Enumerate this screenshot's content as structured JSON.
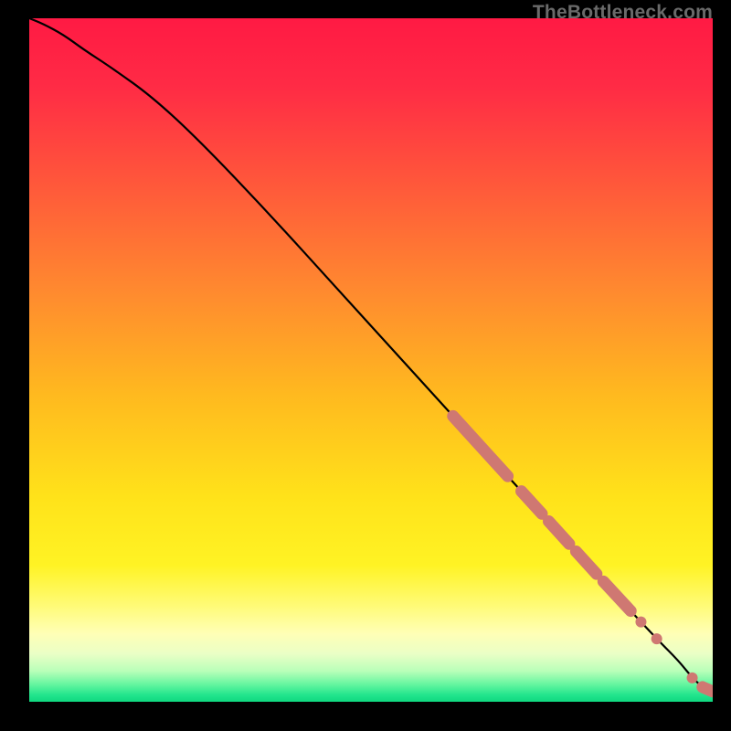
{
  "watermark": "TheBottleneck.com",
  "colors": {
    "page_bg": "#000000",
    "marker": "#cf7872",
    "curve": "#000000",
    "gradient_stops": [
      {
        "offset": 0.0,
        "color": "#ff1a44"
      },
      {
        "offset": 0.1,
        "color": "#ff2b45"
      },
      {
        "offset": 0.25,
        "color": "#ff5a3a"
      },
      {
        "offset": 0.4,
        "color": "#ff8a2f"
      },
      {
        "offset": 0.55,
        "color": "#ffb91f"
      },
      {
        "offset": 0.7,
        "color": "#ffe21a"
      },
      {
        "offset": 0.8,
        "color": "#fff324"
      },
      {
        "offset": 0.86,
        "color": "#fffb78"
      },
      {
        "offset": 0.9,
        "color": "#ffffb6"
      },
      {
        "offset": 0.93,
        "color": "#eaffc6"
      },
      {
        "offset": 0.955,
        "color": "#b9ffb9"
      },
      {
        "offset": 0.975,
        "color": "#63f59f"
      },
      {
        "offset": 0.99,
        "color": "#22e58d"
      },
      {
        "offset": 1.0,
        "color": "#0fd87f"
      }
    ]
  },
  "chart_data": {
    "type": "line",
    "title": "",
    "xlabel": "",
    "ylabel": "",
    "xlim": [
      0,
      100
    ],
    "ylim": [
      0,
      100
    ],
    "grid": false,
    "series": [
      {
        "name": "curve",
        "x": [
          0,
          2,
          5,
          8,
          12,
          18,
          25,
          35,
          45,
          55,
          65,
          75,
          85,
          92,
          95,
          97,
          99,
          100
        ],
        "y": [
          100,
          99.2,
          97.6,
          95.4,
          92.8,
          88.5,
          82.0,
          71.5,
          60.5,
          49.5,
          38.5,
          27.5,
          16.5,
          9.0,
          6.0,
          3.5,
          1.7,
          1.5
        ]
      }
    ],
    "markers": [
      {
        "name": "cluster",
        "x_range": [
          62,
          70
        ],
        "style": "dense-segment"
      },
      {
        "name": "cluster",
        "x_range": [
          72,
          75
        ],
        "style": "dense-segment"
      },
      {
        "name": "cluster",
        "x_range": [
          76,
          79
        ],
        "style": "dense-segment"
      },
      {
        "name": "cluster",
        "x_range": [
          80,
          83
        ],
        "style": "dense-segment"
      },
      {
        "name": "cluster",
        "x_range": [
          84,
          88
        ],
        "style": "dense-segment"
      },
      {
        "name": "point",
        "x": 89.5,
        "style": "dot"
      },
      {
        "name": "point",
        "x": 91.8,
        "style": "dot"
      },
      {
        "name": "point",
        "x": 97.0,
        "style": "dot"
      },
      {
        "name": "cluster",
        "x_range": [
          98.5,
          100
        ],
        "style": "dense-segment"
      }
    ]
  }
}
